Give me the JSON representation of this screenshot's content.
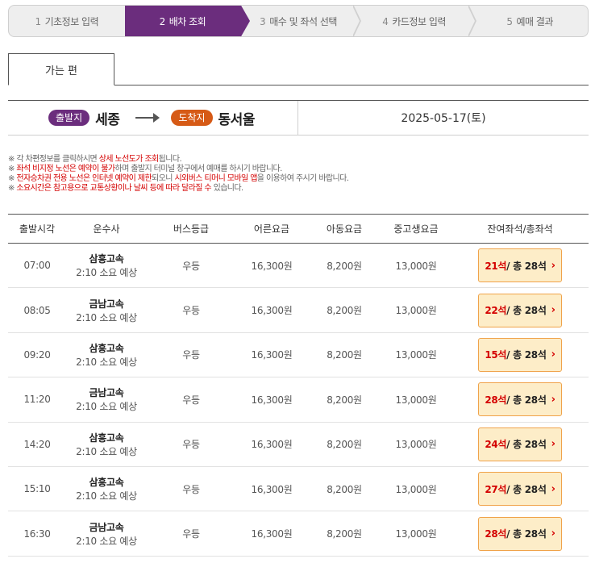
{
  "steps": [
    {
      "num": "1",
      "label": "기초정보 입력"
    },
    {
      "num": "2",
      "label": "배차 조회"
    },
    {
      "num": "3",
      "label": "매수 및 좌석 선택"
    },
    {
      "num": "4",
      "label": "카드정보 입력"
    },
    {
      "num": "5",
      "label": "예매 결과"
    }
  ],
  "tab": {
    "label": "가는 편"
  },
  "route": {
    "dep_badge": "출발지",
    "dep_city": "세종",
    "arr_badge": "도착지",
    "arr_city": "동서울",
    "date": "2025-05-17(토)"
  },
  "notices": {
    "n1_a": "※ 각 차편정보를 클릭하시면 ",
    "n1_b": "상세 노선도가 조회",
    "n1_c": "됩니다.",
    "n2_a": "※ ",
    "n2_b": "좌석 비지정 노선은 예약이 불가",
    "n2_c": "하며 출발지 터미널 창구에서 예매를 하시기 바랍니다.",
    "n3_a": "※ ",
    "n3_b": "전자승차권 전용 노선은 인터넷 예약이 제한",
    "n3_c": "되오니 ",
    "n3_d": "시외버스 티머니 모바일 앱",
    "n3_e": "을 이용하여 주시기 바랍니다.",
    "n4_a": "※ ",
    "n4_b": "소요시간은 참고용으로 교통상황이나 날씨 등에 따라 달라질 수",
    "n4_c": " 있습니다."
  },
  "table": {
    "headers": [
      "출발시각",
      "운수사",
      "버스등급",
      "어른요금",
      "아동요금",
      "중고생요금",
      "잔여좌석/총좌석"
    ],
    "rows": [
      {
        "time": "07:00",
        "company": "삼흥고속",
        "duration": "2:10 소요 예상",
        "grade": "우등",
        "adult": "16,300원",
        "child": "8,200원",
        "student": "13,000원",
        "remain": "21석",
        "total": " / 총 28석"
      },
      {
        "time": "08:05",
        "company": "금남고속",
        "duration": "2:10 소요 예상",
        "grade": "우등",
        "adult": "16,300원",
        "child": "8,200원",
        "student": "13,000원",
        "remain": "22석",
        "total": " / 총 28석"
      },
      {
        "time": "09:20",
        "company": "삼흥고속",
        "duration": "2:10 소요 예상",
        "grade": "우등",
        "adult": "16,300원",
        "child": "8,200원",
        "student": "13,000원",
        "remain": "15석",
        "total": " / 총 28석"
      },
      {
        "time": "11:20",
        "company": "금남고속",
        "duration": "2:10 소요 예상",
        "grade": "우등",
        "adult": "16,300원",
        "child": "8,200원",
        "student": "13,000원",
        "remain": "28석",
        "total": " / 총 28석"
      },
      {
        "time": "14:20",
        "company": "삼흥고속",
        "duration": "2:10 소요 예상",
        "grade": "우등",
        "adult": "16,300원",
        "child": "8,200원",
        "student": "13,000원",
        "remain": "24석",
        "total": " / 총 28석"
      },
      {
        "time": "15:10",
        "company": "삼흥고속",
        "duration": "2:10 소요 예상",
        "grade": "우등",
        "adult": "16,300원",
        "child": "8,200원",
        "student": "13,000원",
        "remain": "27석",
        "total": " / 총 28석"
      },
      {
        "time": "16:30",
        "company": "금남고속",
        "duration": "2:10 소요 예상",
        "grade": "우등",
        "adult": "16,300원",
        "child": "8,200원",
        "student": "13,000원",
        "remain": "28석",
        "total": " / 총 28석"
      }
    ]
  },
  "colors": {
    "primary": "#6b2d7d",
    "arrival": "#d65a16",
    "remain_red": "#d40000",
    "seat_bg": "#fdedc8",
    "seat_border": "#f0a34a"
  }
}
